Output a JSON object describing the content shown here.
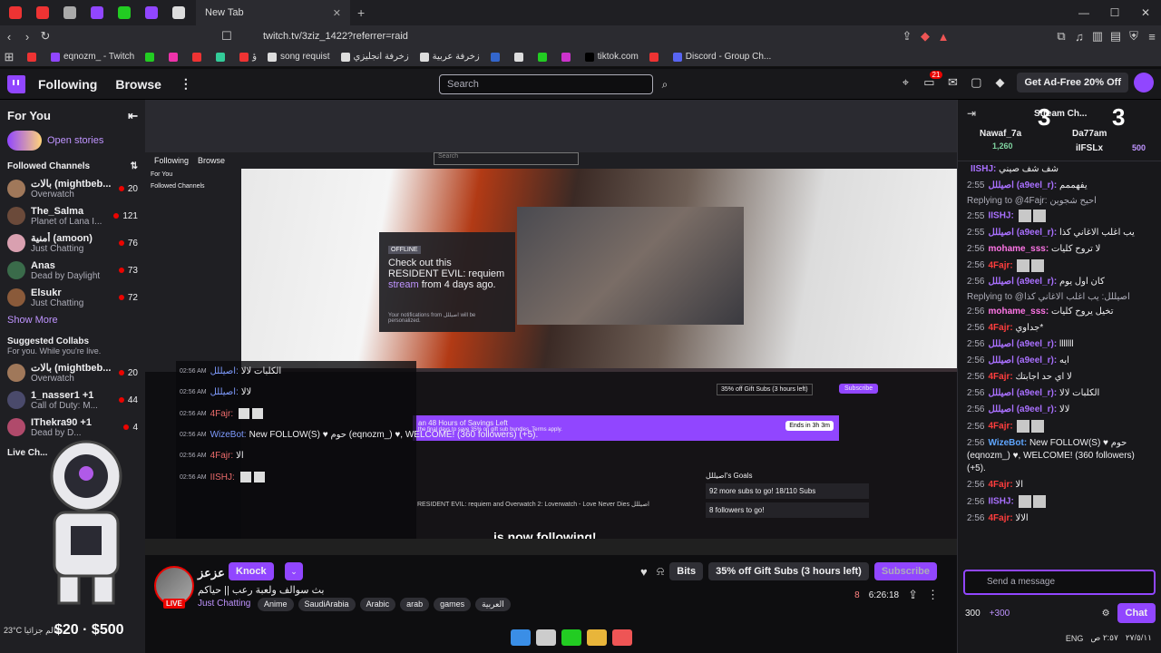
{
  "browser": {
    "tab_title": "New Tab",
    "new_tab_symbol": "+",
    "window_controls": [
      "—",
      "☐",
      "✕"
    ],
    "url": "twitch.tv/3ziz_1422?referrer=raid",
    "bookmarks": [
      "eqnozm_ - Twitch",
      "ؤ",
      "song requist",
      "زخرفة انجليزي",
      "زخرفة عربية",
      "tiktok.com",
      "Discord - Group Ch..."
    ]
  },
  "topnav": {
    "following": "Following",
    "browse": "Browse",
    "more": "⋮",
    "search_placeholder": "Search",
    "notif_badge": "21",
    "ad_free": "Get Ad-Free 20% Off"
  },
  "sidebar": {
    "for_you": "For You",
    "collapse": "⇤",
    "open_stories": "Open stories",
    "followed_title": "Followed Channels",
    "followed": [
      {
        "name": "بالات (mightbeb...",
        "game": "Overwatch",
        "viewers": "20",
        "color": "#a0785a"
      },
      {
        "name": "The_Salma",
        "game": "Planet of Lana I...",
        "viewers": "121",
        "color": "#6b4a3a"
      },
      {
        "name": "أمنية (amoon)",
        "game": "Just Chatting",
        "viewers": "76",
        "color": "#d9a0b0"
      },
      {
        "name": "Anas",
        "game": "Dead by Daylight",
        "viewers": "73",
        "color": "#3a6b4a"
      },
      {
        "name": "Elsukr",
        "game": "Just Chatting",
        "viewers": "72",
        "color": "#8a5a3a"
      }
    ],
    "show_more": "Show More",
    "suggested_title": "Suggested Collabs",
    "suggested_sub": "For you. While you're live.",
    "suggested": [
      {
        "name": "بالات (mightbeb...",
        "game": "Overwatch",
        "viewers": "20",
        "color": "#a0785a"
      },
      {
        "name": "1_nasser1 +1",
        "game": "Call of Duty: M...",
        "viewers": "44",
        "color": "#4a4a6b"
      },
      {
        "name": "IThekra90 +1",
        "game": "Dead by D...",
        "viewers": "4",
        "color": "#b04a6b"
      }
    ],
    "live_channels": "Live Ch...",
    "weather": "23°C عالم جزائيا",
    "price": "$20 · $500"
  },
  "overlay": {
    "offline_tag": "OFFLINE",
    "offline_text_1": "Check out this",
    "offline_text_2": "RESIDENT EVIL: requiem",
    "offline_text_3": "stream",
    "offline_text_4": "from 4 days ago.",
    "offline_note": "Your notifications from اصيللل will be personalized.",
    "chat": [
      {
        "time": "02:56 AM",
        "user": "اصيللل:",
        "msg": "الكلبات لالا",
        "blue": true
      },
      {
        "time": "02:56 AM",
        "user": "اصيللل:",
        "msg": "لالا",
        "blue": true
      },
      {
        "time": "02:56 AM",
        "user": "4Fajr:",
        "msg": "",
        "blue": false
      },
      {
        "time": "02:56 AM",
        "user": "WizeBot:",
        "msg": "New FOLLOW(S) ♥ حوم (eqnozm_) ♥, WELCOME! (360 followers) (+5).",
        "blue": true
      },
      {
        "time": "02:56 AM",
        "user": "4Fajr:",
        "msg": "الا",
        "blue": false
      },
      {
        "time": "02:56 AM",
        "user": "IISHJ:",
        "msg": "",
        "blue": false
      }
    ],
    "banner": "an 48 Hours of Savings Left",
    "banner_sub": "the final days to save 35% on gift sub bundles. Terms apply.",
    "ends_in": "Ends in 3h 3m",
    "gift_subs_small": "35% off Gift Subs (3 hours left)",
    "subscribe_small": "Subscribe",
    "goals_title": "اصيللل's Goals",
    "goal1": "92 more subs to go! 18/110 Subs",
    "goal2": "8 followers to go!",
    "follow_text": "is now following!",
    "bottom_line": "RESIDENT EVIL: requiem and Overwatch 2: Loverwatch - Love Never Dies اصيللل"
  },
  "channel": {
    "name": "عزعز",
    "live": "LIVE",
    "knock": "Knock",
    "title": "بث سوالف ولعبة رعب || حياكم",
    "category": "Just Chatting",
    "tags": [
      "Anime",
      "SaudiArabia",
      "Arabic",
      "arab",
      "games",
      "العربية"
    ],
    "bits": "Bits",
    "gift_subs": "35% off Gift Subs (3 hours left)",
    "subscribe": "Subscribe",
    "viewers": "8",
    "uptime": "6:26:18"
  },
  "chat": {
    "header_title": "Stream Ch...",
    "top_users": [
      "Nawaf_7a",
      "Da77am",
      "iIFSLx"
    ],
    "top_points": [
      "1,260",
      "500"
    ],
    "big_marks": [
      "3",
      "3"
    ],
    "messages": [
      {
        "type": "msg",
        "time": "",
        "user": "IISHJ:",
        "color": "purple",
        "text": "شف شف صيني"
      },
      {
        "type": "msg",
        "time": "2:55",
        "user": "اصيللل (a9eel_r):",
        "color": "purple",
        "text": "يفهممم"
      },
      {
        "type": "reply",
        "text": "Replying to @4Fajr: احيح شجوين"
      },
      {
        "type": "msg",
        "time": "2:55",
        "user": "IISHJ:",
        "color": "purple",
        "text": ""
      },
      {
        "type": "msg",
        "time": "2:55",
        "user": "اصيللل (a9eel_r):",
        "color": "purple",
        "text": "يب اغلب الاغاني كذا"
      },
      {
        "type": "msg",
        "time": "2:56",
        "user": "mohame_sss:",
        "color": "pink",
        "text": "لا تروح كليات"
      },
      {
        "type": "msg",
        "time": "2:56",
        "user": "4Fajr:",
        "color": "red",
        "text": ""
      },
      {
        "type": "msg",
        "time": "2:56",
        "user": "اصيللل (a9eel_r):",
        "color": "purple",
        "text": "كان اول يوم"
      },
      {
        "type": "reply",
        "text": "Replying to @اصيللل: يب اغلب الاغاني كذا"
      },
      {
        "type": "msg",
        "time": "2:56",
        "user": "mohame_sss:",
        "color": "pink",
        "text": "تخيل يروح كليات"
      },
      {
        "type": "msg",
        "time": "2:56",
        "user": "4Fajr:",
        "color": "red",
        "text": "جداوي*"
      },
      {
        "type": "msg",
        "time": "2:56",
        "user": "اصيللل (a9eel_r):",
        "color": "purple",
        "text": "lllllll"
      },
      {
        "type": "msg",
        "time": "2:56",
        "user": "اصيللل (a9eel_r):",
        "color": "purple",
        "text": "ايه"
      },
      {
        "type": "msg",
        "time": "2:56",
        "user": "4Fajr:",
        "color": "red",
        "text": "لا اي حد اجابتك"
      },
      {
        "type": "msg",
        "time": "2:56",
        "user": "اصيللل (a9eel_r):",
        "color": "purple",
        "text": "الكلبات لالا"
      },
      {
        "type": "msg",
        "time": "2:56",
        "user": "اصيللل (a9eel_r):",
        "color": "purple",
        "text": "لالا"
      },
      {
        "type": "msg",
        "time": "2:56",
        "user": "4Fajr:",
        "color": "red",
        "text": ""
      },
      {
        "type": "msg",
        "time": "2:56",
        "user": "WizeBot:",
        "color": "blue",
        "text": "New FOLLOW(S) ♥ حوم (eqnozm_) ♥, WELCOME! (360 followers) (+5)."
      },
      {
        "type": "msg",
        "time": "2:56",
        "user": "4Fajr:",
        "color": "red",
        "text": "الا"
      },
      {
        "type": "msg",
        "time": "2:56",
        "user": "IISHJ:",
        "color": "purple",
        "text": ""
      },
      {
        "type": "msg",
        "time": "2:56",
        "user": "4Fajr:",
        "color": "red",
        "text": "الالا"
      }
    ],
    "input_placeholder": "Send a message",
    "points": "300",
    "points_gain": "+300",
    "chat_button": "Chat"
  },
  "systray": {
    "lang": "ENG",
    "time": "٢:٥٧ ص",
    "date": "٢٧/٥/١١"
  }
}
